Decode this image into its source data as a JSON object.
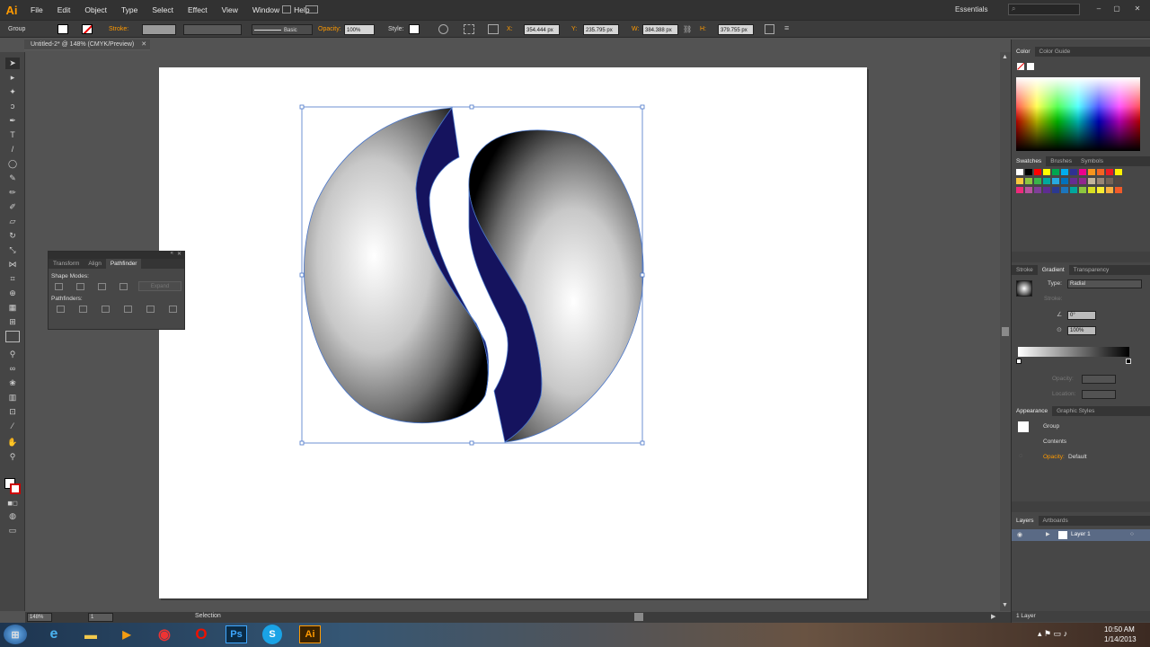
{
  "app": {
    "logo": "Ai",
    "workspace": "Essentials"
  },
  "menu": [
    "File",
    "Edit",
    "Object",
    "Type",
    "Select",
    "Effect",
    "View",
    "Window",
    "Help"
  ],
  "control": {
    "selection_type": "Group",
    "stroke_label": "Stroke:",
    "brush_style": "Basic",
    "opacity_label": "Opacity:",
    "opacity_value": "100%",
    "style_label": "Style:",
    "x_label": "X:",
    "x_value": "354.444 px",
    "y_label": "Y:",
    "y_value": "235.795 px",
    "w_label": "W:",
    "w_value": "384.388 px",
    "h_label": "H:",
    "h_value": "379.755 px"
  },
  "document": {
    "tab_title": "Untitled-2* @ 148% (CMYK/Preview)"
  },
  "pathfinder_panel": {
    "tabs": [
      "Transform",
      "Align",
      "Pathfinder"
    ],
    "shape_modes_label": "Shape Modes:",
    "expand_label": "Expand",
    "pathfinders_label": "Pathfinders:"
  },
  "color_panel": {
    "tabs": [
      "Color",
      "Color Guide"
    ]
  },
  "swatches_panel": {
    "tabs": [
      "Swatches",
      "Brushes",
      "Symbols"
    ]
  },
  "gradient_panel": {
    "tabs": [
      "Stroke",
      "Gradient",
      "Transparency"
    ],
    "type_label": "Type:",
    "type_value": "Radial",
    "stroke_label": "Stroke:",
    "angle_value": "0°",
    "aspect_value": "100%",
    "opacity_label": "Opacity:",
    "location_label": "Location:"
  },
  "appearance_panel": {
    "tabs": [
      "Appearance",
      "Graphic Styles"
    ],
    "group_label": "Group",
    "contents_label": "Contents",
    "opacity_label": "Opacity:",
    "opacity_value": "Default"
  },
  "layers_panel": {
    "tabs": [
      "Layers",
      "Artboards"
    ],
    "layer_name": "Layer 1",
    "count_label": "1 Layer"
  },
  "status": {
    "zoom": "148%",
    "artboard": "1",
    "tool": "Selection"
  },
  "clock": {
    "time": "10:50 AM",
    "date": "1/14/2013"
  },
  "colors": {
    "accent": "#ff9a00",
    "shape_navy": "#15135e",
    "selection": "#4a76c9"
  }
}
